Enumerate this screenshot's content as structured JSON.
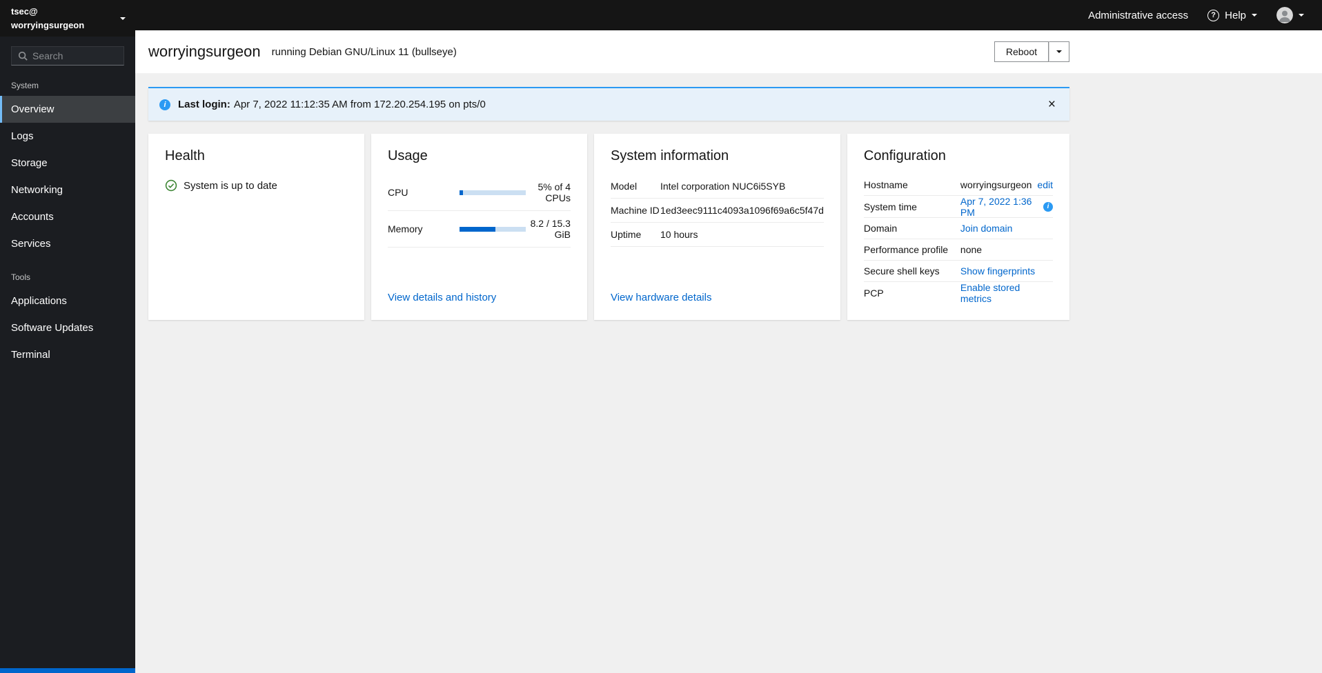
{
  "colors": {
    "accent_link": "#0066cc",
    "alert_info_blue": "#2b9af3",
    "success_green": "#3e8635",
    "progress_fill": "#0066cc",
    "nav_current_indicator": "#73bcf7",
    "sidebar_bg": "#1b1d21",
    "masthead_bg": "#151515"
  },
  "icons": {
    "info": "i",
    "help": "?",
    "close": "×"
  },
  "sidebar": {
    "user": "tsec@",
    "host": "worryingsurgeon",
    "search_placeholder": "Search",
    "current_item": "Overview",
    "sections": [
      {
        "label": "System",
        "items": [
          "Overview",
          "Logs",
          "Storage",
          "Networking",
          "Accounts",
          "Services"
        ]
      },
      {
        "label": "Tools",
        "items": [
          "Applications",
          "Software Updates",
          "Terminal"
        ]
      }
    ]
  },
  "masthead": {
    "admin_access": "Administrative access",
    "help_label": "Help"
  },
  "page": {
    "hostname": "worryingsurgeon",
    "os": "running Debian GNU/Linux 11 (bullseye)",
    "reboot_label": "Reboot"
  },
  "alert": {
    "label": "Last login:",
    "message": "Apr 7, 2022 11:12:35 AM from 172.20.254.195 on pts/0"
  },
  "health": {
    "title": "Health",
    "status": "System is up to date"
  },
  "usage": {
    "title": "Usage",
    "rows": [
      {
        "label": "CPU",
        "value": "5% of 4 CPUs",
        "percent": 5
      },
      {
        "label": "Memory",
        "value": "8.2 / 15.3 GiB",
        "percent": 54
      }
    ],
    "link": "View details and history"
  },
  "system_information": {
    "title": "System information",
    "rows": [
      {
        "label": "Model",
        "value": "Intel corporation NUC6i5SYB"
      },
      {
        "label": "Machine ID",
        "value": "1ed3eec9111c4093a1096f69a6c5f47d"
      },
      {
        "label": "Uptime",
        "value": "10 hours"
      }
    ],
    "link": "View hardware details"
  },
  "configuration": {
    "title": "Configuration",
    "rows": [
      {
        "label": "Hostname",
        "value": "worryingsurgeon",
        "action": "edit"
      },
      {
        "label": "System time",
        "link": "Apr 7, 2022 1:36 PM"
      },
      {
        "label": "Domain",
        "link": "Join domain"
      },
      {
        "label": "Performance profile",
        "value": "none"
      },
      {
        "label": "Secure shell keys",
        "link": "Show fingerprints"
      },
      {
        "label": "PCP",
        "link": "Enable stored metrics"
      }
    ]
  }
}
